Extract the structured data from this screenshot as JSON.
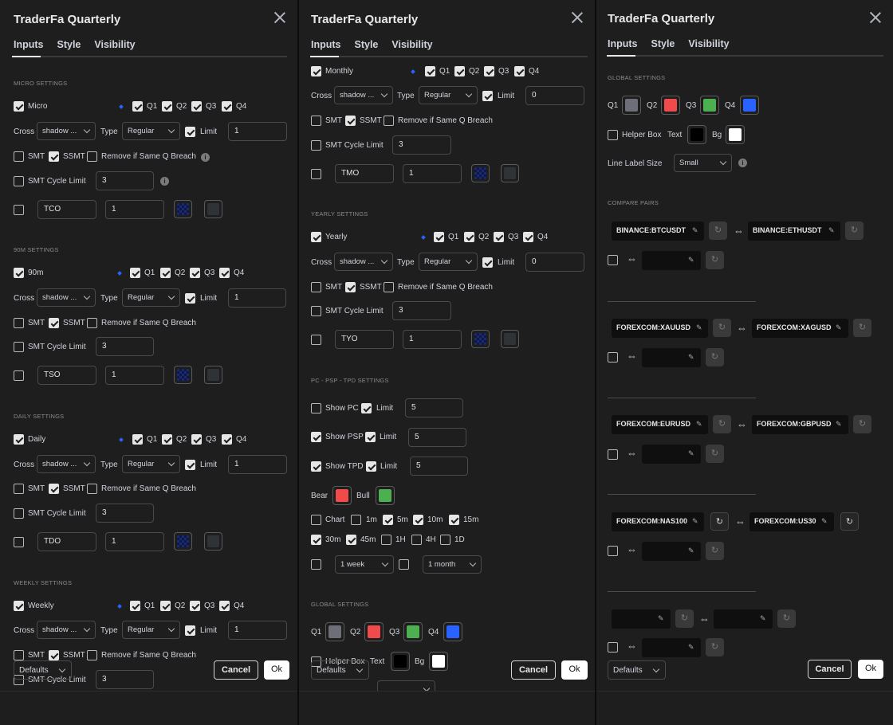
{
  "dialog": {
    "title": "TraderFa Quarterly",
    "tabs": [
      "Inputs",
      "Style",
      "Visibility"
    ],
    "defaults_label": "Defaults",
    "cancel_label": "Cancel",
    "ok_label": "Ok"
  },
  "labels": {
    "cross": "Cross",
    "type": "Type",
    "limit": "Limit",
    "smt": "SMT",
    "ssmt": "SSMT",
    "remove_breach": "Remove if Same Q Breach",
    "smt_cycle_limit": "SMT Cycle Limit",
    "q1": "Q1",
    "q2": "Q2",
    "q3": "Q3",
    "q4": "Q4",
    "bear": "Bear",
    "bull": "Bull",
    "helper_box": "Helper Box",
    "text": "Text",
    "bg": "Bg",
    "line_label_size": "Line Label Size",
    "swap_icon": "⇔"
  },
  "micro": {
    "header": "MICRO SETTINGS",
    "name": "Micro",
    "cross": "shadow ...",
    "type": "Regular",
    "limit": "1",
    "cycle_limit": "3",
    "code": "TCO",
    "code_value": "1"
  },
  "m90": {
    "header": "90M SETTINGS",
    "name": "90m",
    "cross": "shadow ...",
    "type": "Regular",
    "limit": "1",
    "cycle_limit": "3",
    "code": "TSO",
    "code_value": "1"
  },
  "daily": {
    "header": "DAILY SETTINGS",
    "name": "Daily",
    "cross": "shadow ...",
    "type": "Regular",
    "limit": "1",
    "cycle_limit": "3",
    "code": "TDO",
    "code_value": "1"
  },
  "weekly": {
    "header": "WEEKLY SETTINGS",
    "name": "Weekly",
    "cross": "shadow ...",
    "type": "Regular",
    "limit": "1",
    "cycle_limit": "3"
  },
  "monthly": {
    "name": "Monthly",
    "cross": "shadow ...",
    "type": "Regular",
    "limit": "0",
    "cycle_limit": "3",
    "code": "TMO",
    "code_value": "1"
  },
  "yearly": {
    "header": "YEARLY SETTINGS",
    "name": "Yearly",
    "cross": "shadow ...",
    "type": "Regular",
    "limit": "0",
    "cycle_limit": "3",
    "code": "TYO",
    "code_value": "1"
  },
  "pc": {
    "header": "PC - PSP - TPD SETTINGS",
    "show_pc": "Show PC",
    "pc_limit": "5",
    "show_psp": "Show PSP",
    "psp_limit": "5",
    "show_tpd": "Show TPD",
    "tpd_limit": "5",
    "chart": "Chart",
    "tf": [
      "1m",
      "5m",
      "10m",
      "15m",
      "30m",
      "45m",
      "1H",
      "4H",
      "1D"
    ],
    "sel1": "1 week",
    "sel2": "1 month"
  },
  "global": {
    "header": "GLOBAL SETTINGS",
    "label_size": "Small"
  },
  "compare": {
    "header": "COMPARE PAIRS",
    "pairs": [
      {
        "a": "BINANCE:BTCUSDT",
        "b": "BINANCE:ETHUSDT"
      },
      {
        "a": "FOREXCOM:XAUUSD",
        "b": "FOREXCOM:XAGUSD"
      },
      {
        "a": "FOREXCOM:EURUSD",
        "b": "FOREXCOM:GBPUSD"
      },
      {
        "a": "FOREXCOM:NAS100",
        "b": "FOREXCOM:US30"
      }
    ]
  },
  "colors": {
    "q1": "#6e6e78",
    "q2": "#f04a4a",
    "q3": "#4caf50",
    "q4": "#2962ff",
    "bear": "#f04a4a",
    "bull": "#4caf50",
    "text": "#000000",
    "bg": "#ffffff",
    "swatch_dark": "#2f3338"
  }
}
